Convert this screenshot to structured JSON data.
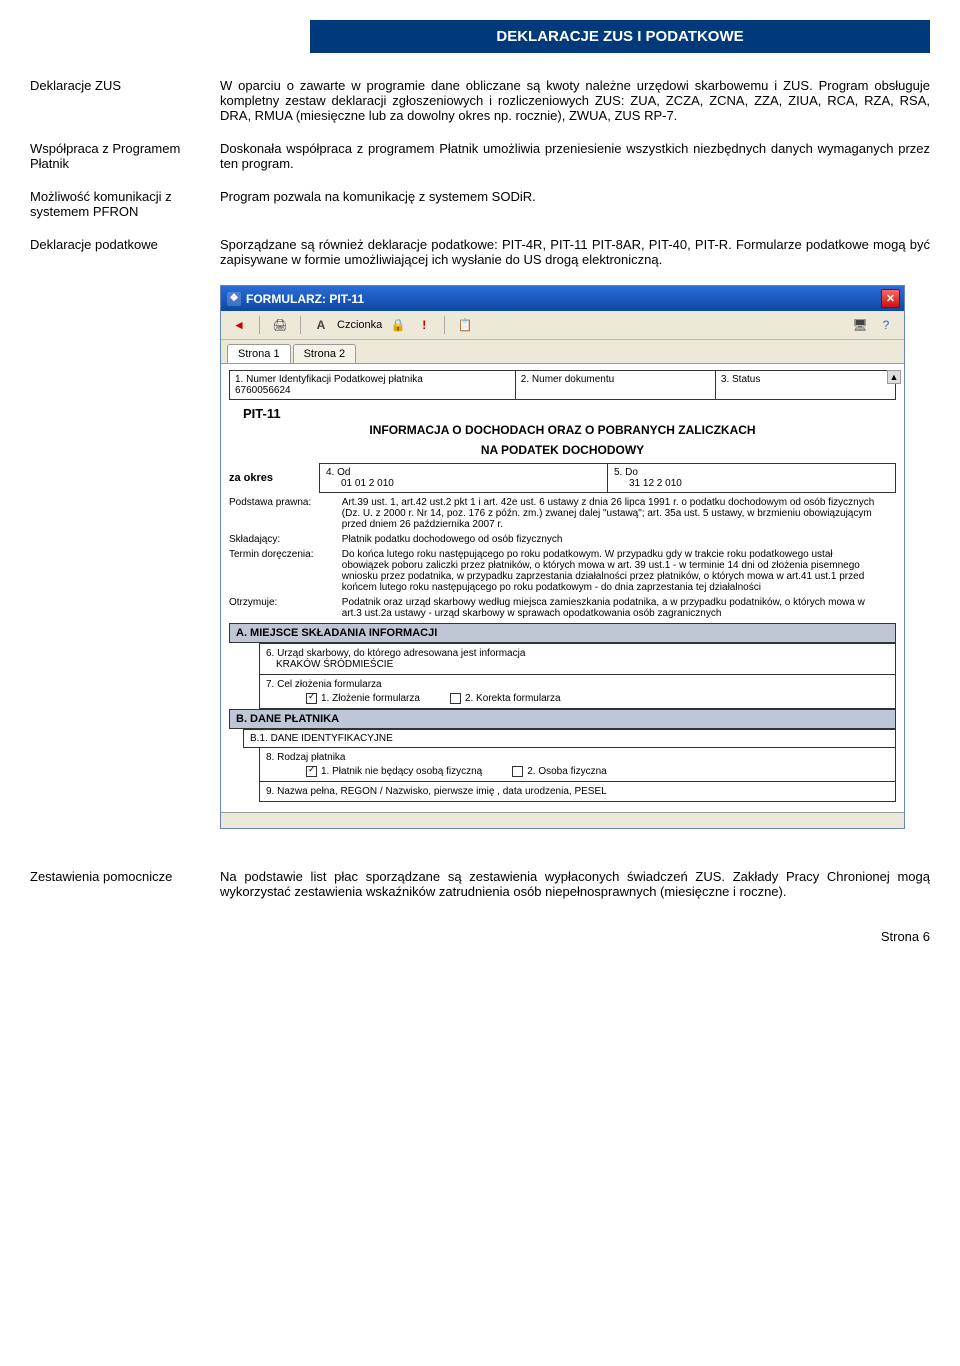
{
  "header": {
    "title": "DEKLARACJE ZUS I PODATKOWE"
  },
  "rows": [
    {
      "label": "Deklaracje ZUS",
      "text": "W oparciu o zawarte w programie dane obliczane są kwoty należne urzędowi skarbowemu i ZUS. Program obsługuje kompletny zestaw deklaracji zgłoszeniowych i rozliczeniowych ZUS: ZUA, ZCZA, ZCNA, ZZA, ZIUA, RCA, RZA, RSA, DRA, RMUA (miesięczne lub za dowolny okres np. rocznie), ZWUA, ZUS RP-7."
    },
    {
      "label": "Współpraca z Programem Płatnik",
      "text": "Doskonała współpraca z programem Płatnik umożliwia przeniesienie wszystkich niezbędnych danych wymaganych przez ten program."
    },
    {
      "label": "Możliwość komunikacji z systemem PFRON",
      "text": "Program pozwala na komunikację z systemem SODiR."
    },
    {
      "label": "Deklaracje podatkowe",
      "text": "Sporządzane są również deklaracje podatkowe: PIT-4R, PIT-11 PIT-8AR, PIT-40, PIT-R. Formularze podatkowe mogą być zapisywane w formie umożliwiającej ich wysłanie do US drogą elektroniczną."
    }
  ],
  "window": {
    "title": "FORMULARZ:  PIT-11",
    "toolbar": {
      "font_label": "Czcionka"
    },
    "tabs": [
      "Strona 1",
      "Strona 2"
    ],
    "fields": {
      "f1_label": "1. Numer Identyfikacji Podatkowej płatnika",
      "f1_value": "6760056624",
      "f2_label": "2. Numer dokumentu",
      "f3_label": "3. Status"
    },
    "form_name": "PIT-11",
    "subtitle1": "INFORMACJA O DOCHODACH ORAZ O POBRANYCH ZALICZKACH",
    "subtitle2": "NA PODATEK DOCHODOWY",
    "period_label": "za okres",
    "date_from_label": "4. Od",
    "date_from": "01    01    2 010",
    "date_to_label": "5. Do",
    "date_to": "31    12    2 010",
    "podstawa_label": "Podstawa prawna:",
    "podstawa_text": "Art.39 ust. 1, art.42 ust.2 pkt 1 i art. 42e ust. 6 ustawy z dnia 26 lipca 1991 r. o podatku dochodowym od osób fizycznych (Dz. U. z 2000 r. Nr 14, poz. 176 z późn. zm.) zwanej dalej \"ustawą\"; art. 35a ust. 5 ustawy, w brzmieniu obowiązującym przed dniem 26 października 2007 r.",
    "skladajacy_label": "Składający:",
    "skladajacy_text": "Płatnik podatku dochodowego od osób fizycznych",
    "termin_label": "Termin doręczenia:",
    "termin_text": "Do końca lutego roku następującego po roku podatkowym. W przypadku gdy w trakcie roku podatkowego ustał obowiązek poboru zaliczki przez płatników, o których mowa w art. 39 ust.1 - w terminie 14 dni od złożenia pisemnego wniosku przez podatnika, w przypadku zaprzestania działalności przez płatników, o których mowa w art.41 ust.1 przed końcem lutego roku następującego po roku podatkowym - do dnia zaprzestania tej działalności",
    "otrzymuje_label": "Otrzymuje:",
    "otrzymuje_text": "Podatnik oraz urząd skarbowy według miejsca zamieszkania podatnika, a w przypadku podatników, o których mowa w art.3 ust.2a ustawy - urząd skarbowy w sprawach opodatkowania osób zagranicznych",
    "secA": "A. MIEJSCE SKŁADANIA INFORMACJI",
    "f6": "6. Urząd skarbowy, do którego adresowana jest informacja",
    "f6_value": "KRAKÓW ŚRÓDMIEŚCIE",
    "f7": "7. Cel złożenia formularza",
    "chk1": "1. Złożenie formularza",
    "chk2": "2. Korekta formularza",
    "secB": "B. DANE PŁATNIKA",
    "secB1": "B.1. DANE IDENTYFIKACYJNE",
    "f8": "8. Rodzaj płatnika",
    "chk3": "1. Płatnik nie będący osobą fizyczną",
    "chk4": "2. Osoba fizyczna",
    "f9": "9. Nazwa pełna, REGON / Nazwisko, pierwsze imię , data urodzenia, PESEL"
  },
  "bottom": {
    "label": "Zestawienia pomocnicze",
    "text": "Na podstawie list płac sporządzane są zestawienia wypłaconych świadczeń ZUS. Zakłady Pracy Chronionej mogą wykorzystać zestawienia wskaźników zatrudnienia osób niepełnosprawnych (miesięczne i roczne)."
  },
  "footer": {
    "page": "Strona 6"
  }
}
